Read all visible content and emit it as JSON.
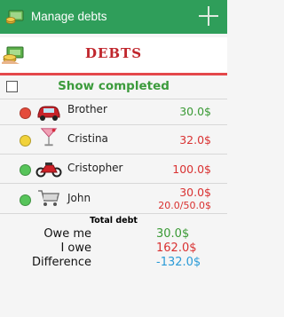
{
  "app_bar": {
    "title": "Manage debts"
  },
  "header": {
    "title": "DEBTS"
  },
  "filter": {
    "label": "Show completed",
    "checked": false
  },
  "debts": [
    {
      "name": "Brother",
      "amount": "30.0$",
      "amount_color": "#3a9a35",
      "status_color": "#e44b3b",
      "icon": "car-icon"
    },
    {
      "name": "Cristina",
      "amount": "32.0$",
      "amount_color": "#d93232",
      "status_color": "#f1d23a",
      "icon": "cocktail-icon"
    },
    {
      "name": "Cristopher",
      "amount": "100.0$",
      "amount_color": "#d93232",
      "status_color": "#57c45a",
      "icon": "motorbike-icon"
    },
    {
      "name": "John",
      "amount": "30.0$",
      "amount_color": "#d93232",
      "partial": "20.0/50.0$",
      "status_color": "#57c45a",
      "icon": "cart-icon"
    }
  ],
  "totals": {
    "title": "Total debt",
    "owe_me_label": "Owe me",
    "owe_me_value": "30.0$",
    "owe_me_color": "#3a9a35",
    "i_owe_label": "I owe",
    "i_owe_value": "162.0$",
    "i_owe_color": "#d93232",
    "difference_label": "Difference",
    "difference_value": "-132.0$",
    "difference_color": "#2a9bd7"
  }
}
